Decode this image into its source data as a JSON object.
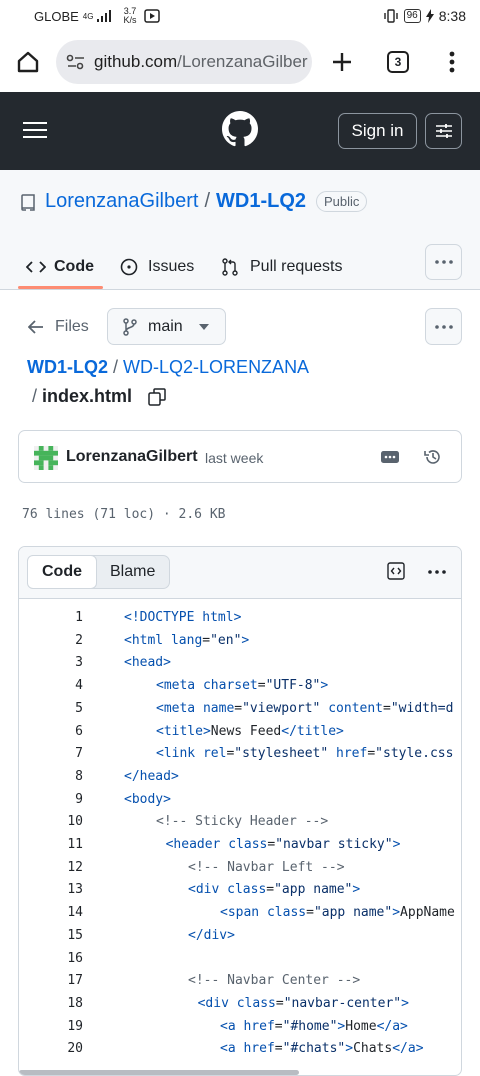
{
  "status_bar": {
    "carrier": "GLOBE",
    "signal_type": "4G",
    "net_speed": "3.7",
    "net_unit": "K/s",
    "battery": "96",
    "time": "8:38"
  },
  "browser": {
    "url_host": "github.com",
    "url_path": "/LorenzanaGilber",
    "tab_count": "3"
  },
  "github_nav": {
    "sign_in_label": "Sign in"
  },
  "repo": {
    "owner": "LorenzanaGilbert",
    "separator": "/",
    "name": "WD1-LQ2",
    "visibility": "Public"
  },
  "repo_tabs": [
    {
      "label": "Code"
    },
    {
      "label": "Issues"
    },
    {
      "label": "Pull requests"
    }
  ],
  "file_nav": {
    "files_label": "Files",
    "branch": "main",
    "path_root": "WD1-LQ2",
    "path_sep": "/",
    "path_folder": "WD-LQ2-LORENZANA",
    "path_sep2": "/",
    "file_name": "index.html"
  },
  "commit": {
    "author": "LorenzanaGilbert",
    "time": "last week"
  },
  "file_stats": {
    "text": "76 lines (71 loc) · 2.6 KB"
  },
  "code_view": {
    "code_tab": "Code",
    "blame_tab": "Blame"
  },
  "code_lines": [
    {
      "n": "1",
      "indent": 0,
      "parts": [
        [
          "tag",
          "<!DOCTYPE html>"
        ]
      ]
    },
    {
      "n": "2",
      "indent": 0,
      "parts": [
        [
          "tag",
          "<html "
        ],
        [
          "attr",
          "lang"
        ],
        [
          "txt",
          "="
        ],
        [
          "str",
          "\"en\""
        ],
        [
          "tag",
          ">"
        ]
      ]
    },
    {
      "n": "3",
      "indent": 0,
      "parts": [
        [
          "tag",
          "<head>"
        ]
      ]
    },
    {
      "n": "4",
      "indent": 1,
      "parts": [
        [
          "tag",
          "<meta "
        ],
        [
          "attr",
          "charset"
        ],
        [
          "txt",
          "="
        ],
        [
          "str",
          "\"UTF-8\""
        ],
        [
          "tag",
          ">"
        ]
      ]
    },
    {
      "n": "5",
      "indent": 1,
      "parts": [
        [
          "tag",
          "<meta "
        ],
        [
          "attr",
          "name"
        ],
        [
          "txt",
          "="
        ],
        [
          "str",
          "\"viewport\""
        ],
        [
          "txt",
          " "
        ],
        [
          "attr",
          "content"
        ],
        [
          "txt",
          "="
        ],
        [
          "str",
          "\"width=d"
        ]
      ]
    },
    {
      "n": "6",
      "indent": 1,
      "parts": [
        [
          "tag",
          "<title>"
        ],
        [
          "txt",
          "News Feed"
        ],
        [
          "tag",
          "</title>"
        ]
      ]
    },
    {
      "n": "7",
      "indent": 1,
      "parts": [
        [
          "tag",
          "<link "
        ],
        [
          "attr",
          "rel"
        ],
        [
          "txt",
          "="
        ],
        [
          "str",
          "\"stylesheet\""
        ],
        [
          "txt",
          " "
        ],
        [
          "attr",
          "href"
        ],
        [
          "txt",
          "="
        ],
        [
          "str",
          "\"style.css"
        ]
      ]
    },
    {
      "n": "8",
      "indent": 0,
      "parts": [
        [
          "tag",
          "</head>"
        ]
      ]
    },
    {
      "n": "9",
      "indent": 0,
      "parts": [
        [
          "tag",
          "<body>"
        ]
      ]
    },
    {
      "n": "10",
      "indent": 1,
      "parts": [
        [
          "cmt",
          "<!-- Sticky Header -->"
        ]
      ]
    },
    {
      "n": "11",
      "indent": 1.3,
      "parts": [
        [
          "tag",
          "<header "
        ],
        [
          "attr",
          "class"
        ],
        [
          "txt",
          "="
        ],
        [
          "str",
          "\"navbar sticky\""
        ],
        [
          "tag",
          ">"
        ]
      ]
    },
    {
      "n": "12",
      "indent": 2,
      "parts": [
        [
          "cmt",
          "<!-- Navbar Left -->"
        ]
      ]
    },
    {
      "n": "13",
      "indent": 2,
      "parts": [
        [
          "tag",
          "<div "
        ],
        [
          "attr",
          "class"
        ],
        [
          "txt",
          "="
        ],
        [
          "str",
          "\"app name\""
        ],
        [
          "tag",
          ">"
        ]
      ]
    },
    {
      "n": "14",
      "indent": 3,
      "parts": [
        [
          "tag",
          "<span "
        ],
        [
          "attr",
          "class"
        ],
        [
          "txt",
          "="
        ],
        [
          "str",
          "\"app name\""
        ],
        [
          "tag",
          ">"
        ],
        [
          "txt",
          "AppName"
        ]
      ]
    },
    {
      "n": "15",
      "indent": 2,
      "parts": [
        [
          "tag",
          "</div>"
        ]
      ]
    },
    {
      "n": "16",
      "indent": 0,
      "parts": []
    },
    {
      "n": "17",
      "indent": 2,
      "parts": [
        [
          "cmt",
          "<!-- Navbar Center -->"
        ]
      ]
    },
    {
      "n": "18",
      "indent": 2.3,
      "parts": [
        [
          "tag",
          "<div "
        ],
        [
          "attr",
          "class"
        ],
        [
          "txt",
          "="
        ],
        [
          "str",
          "\"navbar-center\""
        ],
        [
          "tag",
          ">"
        ]
      ]
    },
    {
      "n": "19",
      "indent": 3,
      "parts": [
        [
          "tag",
          "<a "
        ],
        [
          "attr",
          "href"
        ],
        [
          "txt",
          "="
        ],
        [
          "str",
          "\"#home\""
        ],
        [
          "tag",
          ">"
        ],
        [
          "txt",
          "Home"
        ],
        [
          "tag",
          "</a>"
        ]
      ]
    },
    {
      "n": "20",
      "indent": 3,
      "parts": [
        [
          "tag",
          "<a "
        ],
        [
          "attr",
          "href"
        ],
        [
          "txt",
          "="
        ],
        [
          "str",
          "\"#chats\""
        ],
        [
          "tag",
          ">"
        ],
        [
          "txt",
          "Chats"
        ],
        [
          "tag",
          "</a>"
        ]
      ]
    }
  ],
  "colors": {
    "nav_bg": "#24292f",
    "link": "#0969da",
    "tab_underline": "#fd8c73",
    "code_tag": "#0550ae"
  }
}
